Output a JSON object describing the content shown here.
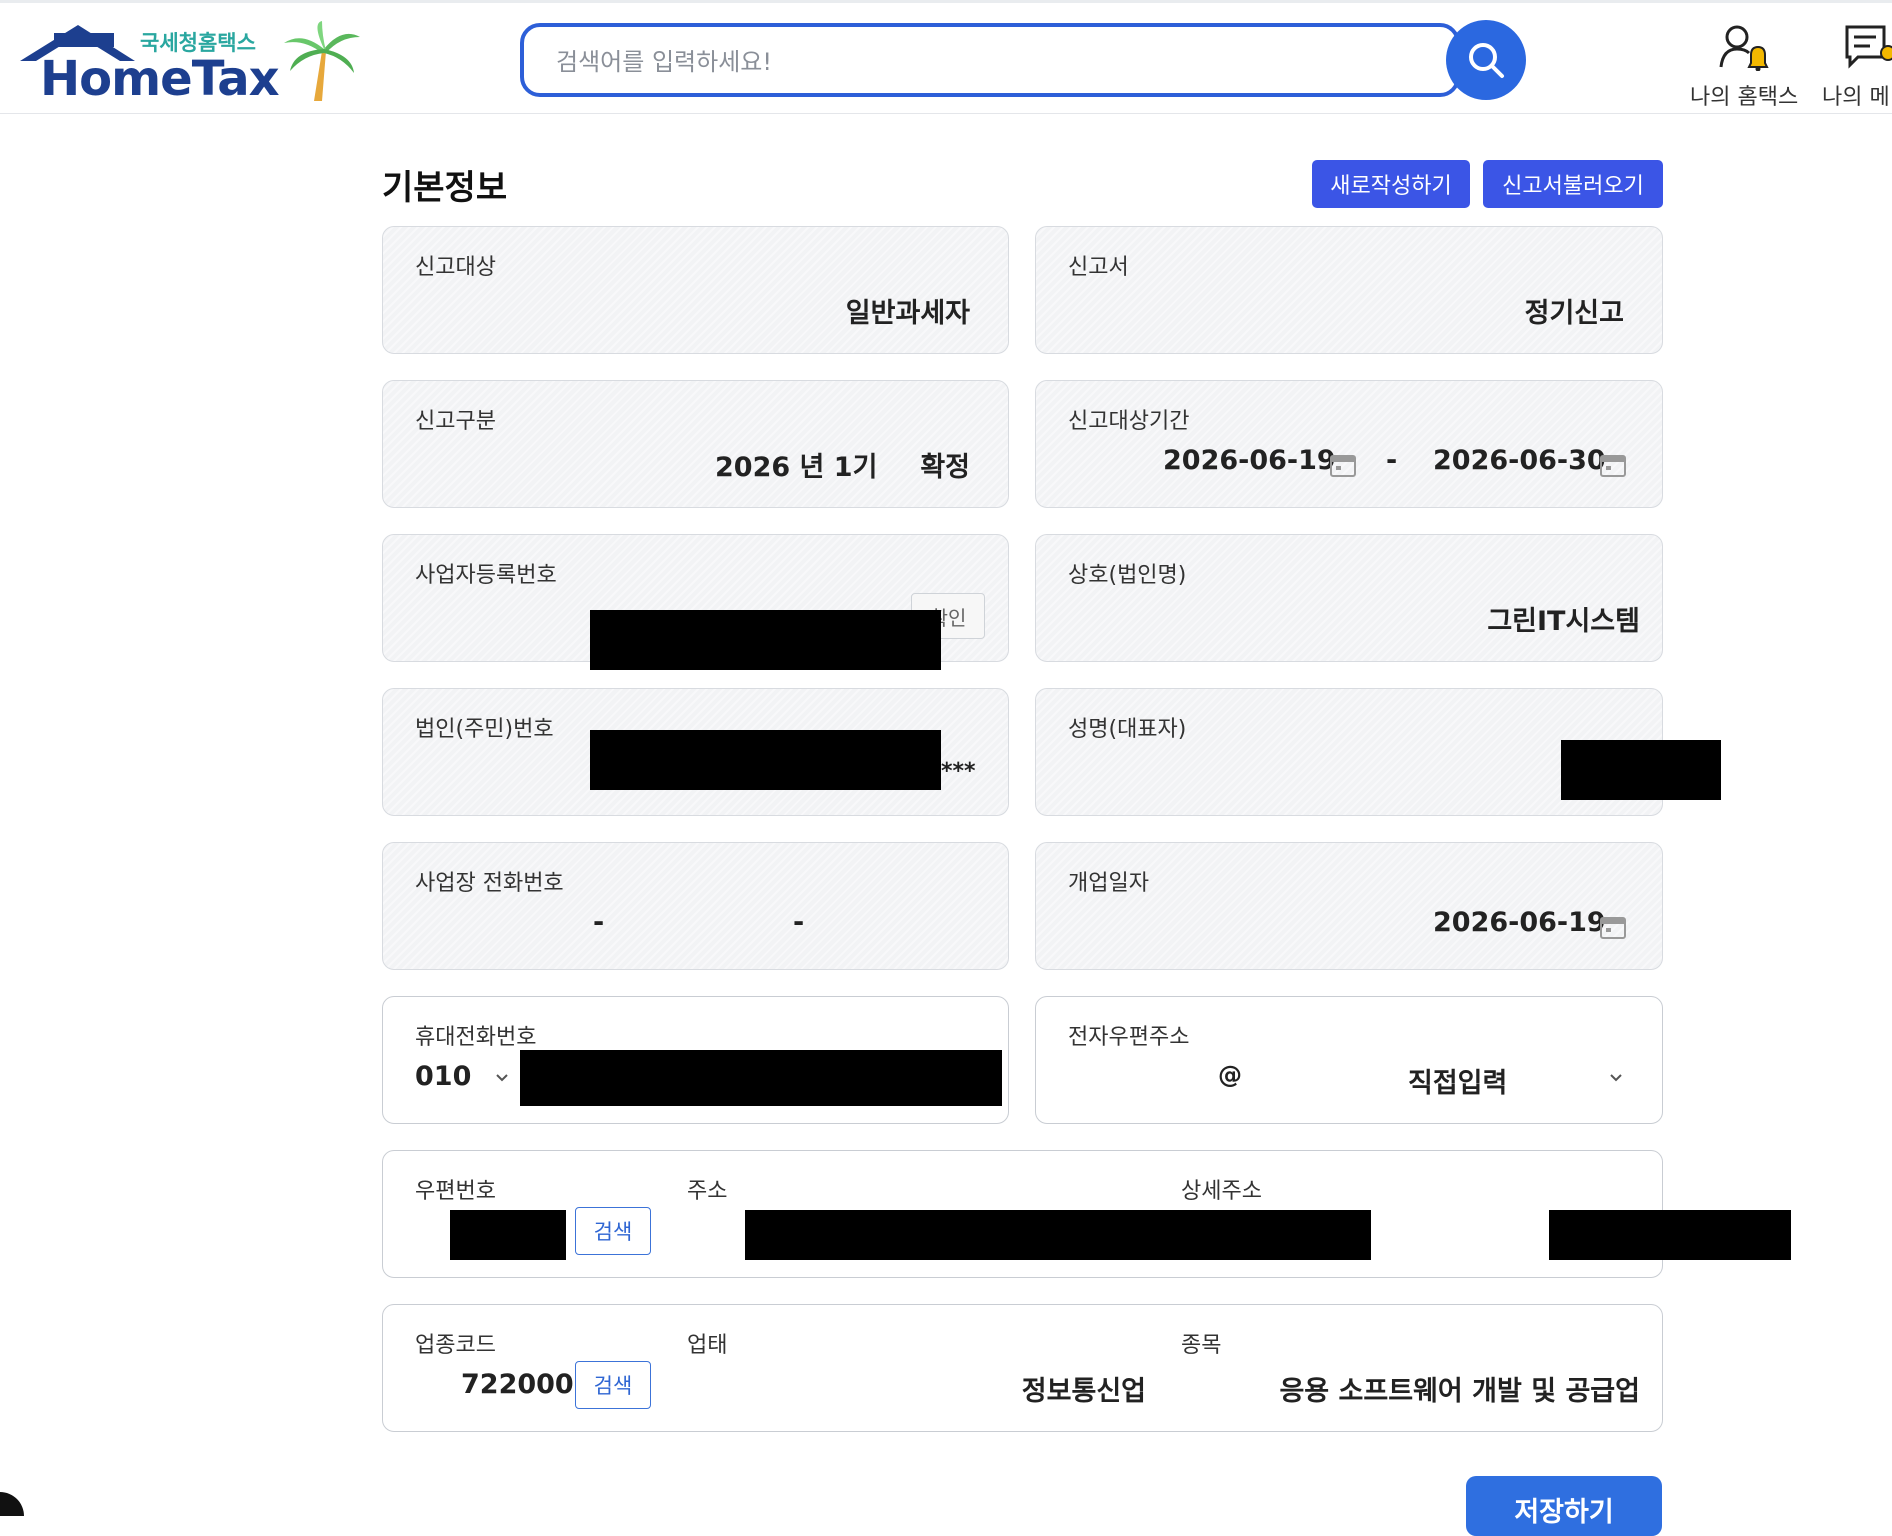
{
  "header": {
    "logo_sub": "국세청홈택스",
    "logo_main": "HomeTax",
    "search_placeholder": "검색어를 입력하세요!",
    "my_hometax_label": "나의 홈택스",
    "my_menu_label": "나의 메"
  },
  "section": {
    "title": "기본정보",
    "new_button": "새로작성하기",
    "load_button": "신고서불러오기"
  },
  "fields": {
    "report_target": {
      "label": "신고대상",
      "value": "일반과세자"
    },
    "report_form": {
      "label": "신고서",
      "value": "정기신고"
    },
    "report_type": {
      "label": "신고구분",
      "year_period": "2026 년 1기",
      "type": "확정"
    },
    "report_period": {
      "label": "신고대상기간",
      "start": "2026-06-19",
      "separator": "-",
      "end": "2026-06-30"
    },
    "business_reg_no": {
      "label": "사업자등록번호",
      "value": "",
      "confirm_button": "확인"
    },
    "company_name": {
      "label": "상호(법인명)",
      "value": "그린IT시스템"
    },
    "corp_id_no": {
      "label": "법인(주민)번호",
      "masked_suffix": "***"
    },
    "rep_name": {
      "label": "성명(대표자)"
    },
    "business_phone": {
      "label": "사업장 전화번호",
      "sep1": "-",
      "sep2": "-"
    },
    "open_date": {
      "label": "개업일자",
      "value": "2026-06-19"
    },
    "mobile": {
      "label": "휴대전화번호",
      "prefix": "010"
    },
    "email": {
      "label": "전자우편주소",
      "at": "@",
      "domain_select": "직접입력"
    },
    "address": {
      "zip_label": "우편번호",
      "addr_label": "주소",
      "detail_label": "상세주소",
      "search_button": "검색"
    },
    "industry": {
      "code_label": "업종코드",
      "code": "722000",
      "search_button": "검색",
      "type_label": "업태",
      "type_value": "정보통신업",
      "item_label": "종목",
      "item_value": "응용 소프트웨어 개발 및 공급업"
    }
  },
  "footer": {
    "save_button": "저장하기"
  },
  "colors": {
    "primary": "#3b55e6",
    "search_blue": "#2b68e0",
    "logo_blue": "#1d3f8f",
    "logo_teal": "#2aa7a0"
  }
}
